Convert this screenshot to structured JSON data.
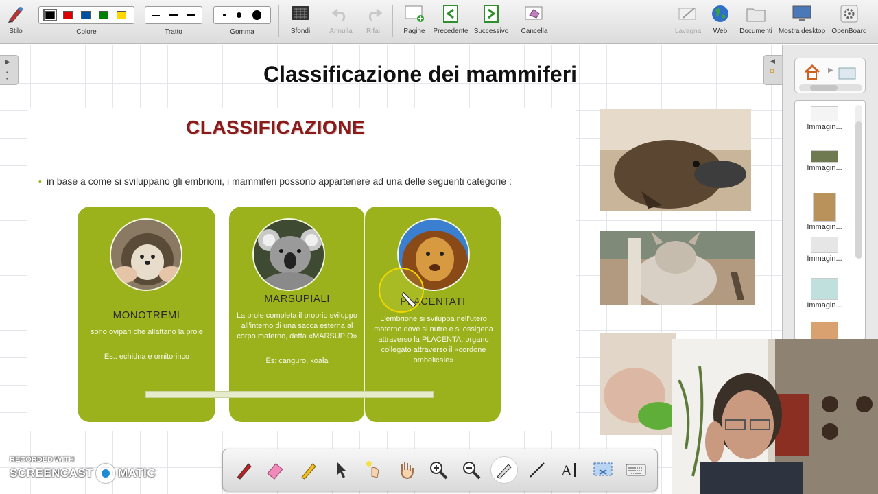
{
  "toolbar": {
    "stilo": "Stilo",
    "colore": "Colore",
    "tratto": "Tratto",
    "gomma": "Gomma",
    "sfondi": "Sfondi",
    "annulla": "Annulla",
    "rifai": "Rifai",
    "pagine": "Pagine",
    "precedente": "Precedente",
    "successivo": "Successivo",
    "cancella": "Cancella",
    "lavagna": "Lavagna",
    "web": "Web",
    "documenti": "Documenti",
    "mostra_desktop": "Mostra desktop",
    "openboard": "OpenBoard",
    "colors": [
      "#000000",
      "#e00000",
      "#0050a0",
      "#008000",
      "#ffd800"
    ]
  },
  "board": {
    "title": "Classificazione dei mammiferi"
  },
  "slide": {
    "title": "CLASSIFICAZIONE",
    "bullet": "in base a  come si sviluppano gli embrioni, i mammiferi possono appartenere ad una delle seguenti categorie :",
    "accent_color": "#9bb21d",
    "cards": [
      {
        "head": "MONOTREMI",
        "desc": "sono ovipari che allattano la prole",
        "example": "Es.: echidna e ornitorinco"
      },
      {
        "head": "MARSUPIALI",
        "desc": "La prole completa il proprio sviluppo all'interno di una sacca esterna al corpo materno, detta «MARSUPIO»",
        "example": "Es:  canguro, koala"
      },
      {
        "head": "PLACENTATI",
        "desc": "L'embrione si sviluppa  nell'utero materno dove si nutre e si ossigena attraverso la PLACENTA, organo collegato attraverso il «cordone ombelicale»"
      }
    ]
  },
  "sidebar": {
    "thumbnails": [
      {
        "label": "Immagin..."
      },
      {
        "label": "Immagin..."
      },
      {
        "label": "Immagin..."
      },
      {
        "label": "Immagin..."
      },
      {
        "label": "Immagin..."
      }
    ]
  },
  "watermark": {
    "small": "RECORDED WITH",
    "big_left": "SCREENCAST",
    "big_right": "MATIC"
  },
  "icons": {
    "bottom_tools": [
      "pen-icon",
      "eraser-icon",
      "highlighter-icon",
      "pointer-icon",
      "laser-icon",
      "hand-icon",
      "zoom-in-icon",
      "zoom-out-icon",
      "capture-icon",
      "line-icon",
      "text-icon",
      "select-icon",
      "keyboard-icon"
    ]
  }
}
